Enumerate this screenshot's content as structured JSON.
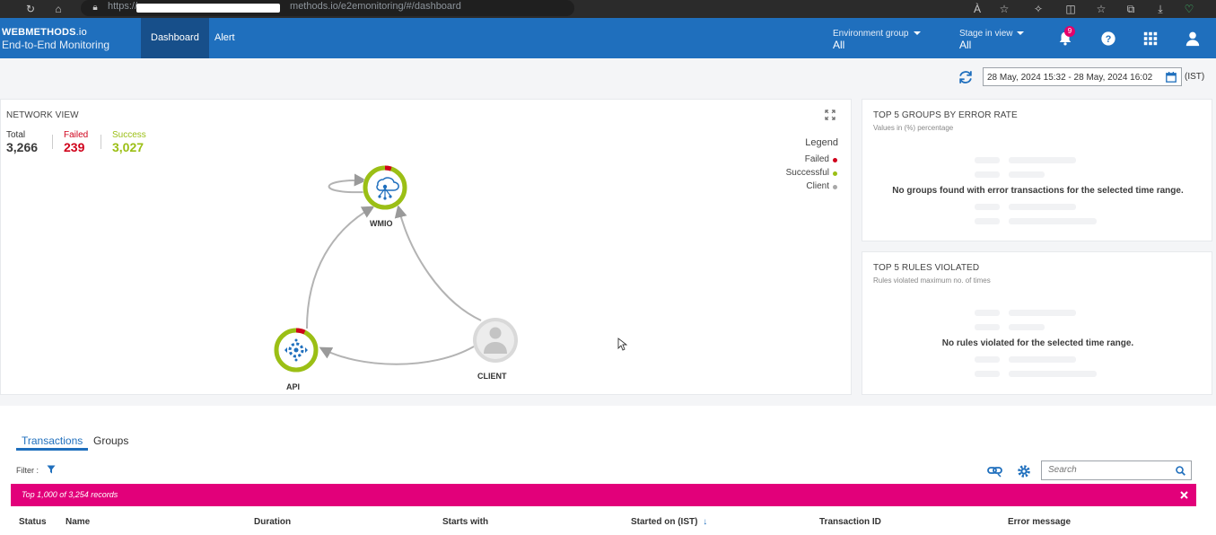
{
  "browser": {
    "url_prefix": "https://",
    "url_suffix": "methods.io/e2emonitoring/#/dashboard"
  },
  "header": {
    "brand_name": "WEBMETHODS",
    "brand_suffix": ".io",
    "brand_subtitle": "End-to-End Monitoring",
    "tabs": [
      {
        "label": "Dashboard",
        "active": true
      },
      {
        "label": "Alert",
        "active": false
      }
    ],
    "environment_group": {
      "label": "Environment group",
      "value": "All"
    },
    "stage_in_view": {
      "label": "Stage in view",
      "value": "All"
    },
    "notification_count": "9",
    "icons": [
      "bell-icon",
      "help-icon",
      "apps-grid-icon",
      "user-icon"
    ]
  },
  "time_range": {
    "value": "28 May, 2024 15:32 - 28 May, 2024 16:02",
    "timezone": "(IST)"
  },
  "network_view": {
    "title": "NETWORK VIEW",
    "stats": {
      "total_label": "Total",
      "total_value": "3,266",
      "failed_label": "Failed",
      "failed_value": "239",
      "success_label": "Success",
      "success_value": "3,027"
    },
    "legend": {
      "title": "Legend",
      "items": [
        {
          "label": "Failed",
          "color": "#d0021b"
        },
        {
          "label": "Successful",
          "color": "#9bbf15"
        },
        {
          "label": "Client",
          "color": "#a8a8a8"
        }
      ]
    },
    "nodes": [
      {
        "label": "WMIO",
        "icon": "integration-hub-icon",
        "failure_fraction": 0.05
      },
      {
        "label": "API",
        "icon": "api-gear-icon",
        "failure_fraction": 0.07
      },
      {
        "label": "CLIENT",
        "icon": "client-user-icon"
      }
    ],
    "colors": {
      "success": "#9bbf15",
      "failed": "#d0021b",
      "client": "#d9d9d9",
      "edge": "#b3b3b3"
    }
  },
  "top_groups": {
    "title": "TOP 5 GROUPS BY ERROR RATE",
    "subtitle": "Values in (%) percentage",
    "empty_message": "No groups found with error transactions for the selected time range."
  },
  "top_rules": {
    "title": "TOP 5 RULES VIOLATED",
    "subtitle": "Rules violated maximum no. of times",
    "empty_message": "No rules violated for the selected time range."
  },
  "transactions": {
    "tabs": [
      {
        "label": "Transactions",
        "active": true
      },
      {
        "label": "Groups",
        "active": false
      }
    ],
    "filter_label": "Filter :",
    "search_placeholder": "Search",
    "records_message": "Top 1,000 of 3,254 records",
    "columns": [
      "Status",
      "Name",
      "Duration",
      "Starts with",
      "Started on (IST)",
      "Transaction ID",
      "Error message"
    ]
  },
  "brand_colors": {
    "header": "#1f6fbd",
    "records_bar": "#e2007a"
  }
}
